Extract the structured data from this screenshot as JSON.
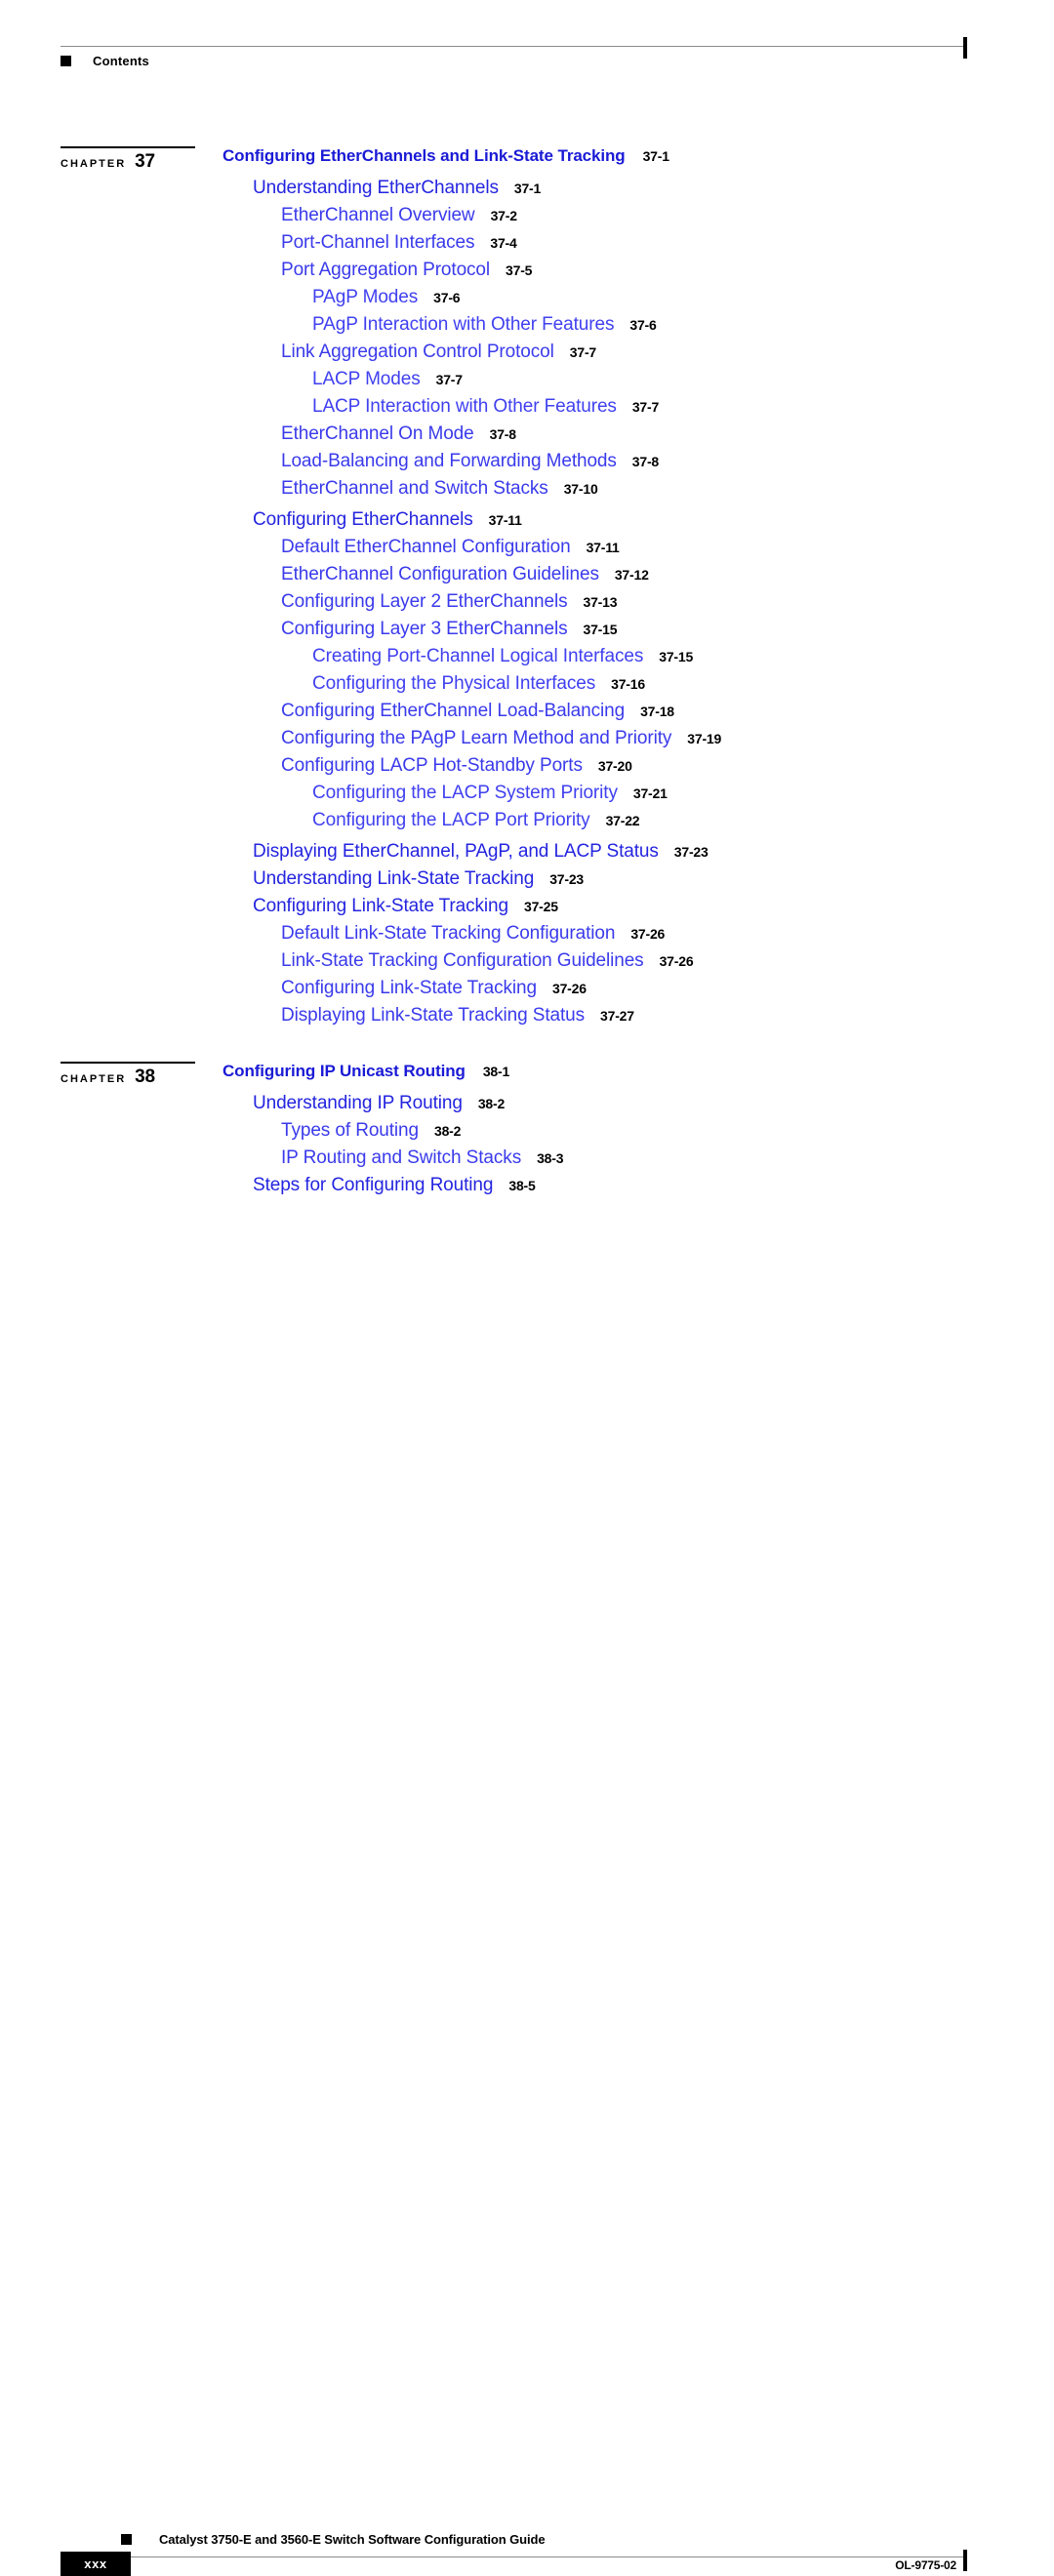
{
  "header": {
    "label": "Contents",
    "square_icon": "black-square-marker"
  },
  "colors": {
    "chapter_title_blue": "#1a1ad6",
    "level1_blue": "#2424e0",
    "level2_blue": "#3a3aec",
    "level3_blue": "#4040f0",
    "page_number_black": "#000000"
  },
  "toc": {
    "chapters": [
      {
        "chapter_word": "CHAPTER",
        "chapter_number": "37",
        "entries": [
          {
            "level": 0,
            "title": "Configuring EtherChannels and Link-State Tracking",
            "page": "37-1",
            "gap_before": false
          },
          {
            "level": 1,
            "title": "Understanding EtherChannels",
            "page": "37-1",
            "gap_before": false
          },
          {
            "level": 2,
            "title": "EtherChannel Overview",
            "page": "37-2",
            "gap_before": false
          },
          {
            "level": 2,
            "title": "Port-Channel Interfaces",
            "page": "37-4",
            "gap_before": false
          },
          {
            "level": 2,
            "title": "Port Aggregation Protocol",
            "page": "37-5",
            "gap_before": false
          },
          {
            "level": 3,
            "title": "PAgP Modes",
            "page": "37-6",
            "gap_before": false
          },
          {
            "level": 3,
            "title": "PAgP Interaction with Other Features",
            "page": "37-6",
            "gap_before": false
          },
          {
            "level": 2,
            "title": "Link Aggregation Control Protocol",
            "page": "37-7",
            "gap_before": false
          },
          {
            "level": 3,
            "title": "LACP Modes",
            "page": "37-7",
            "gap_before": false
          },
          {
            "level": 3,
            "title": "LACP Interaction with Other Features",
            "page": "37-7",
            "gap_before": false
          },
          {
            "level": 2,
            "title": "EtherChannel On Mode",
            "page": "37-8",
            "gap_before": false
          },
          {
            "level": 2,
            "title": "Load-Balancing and Forwarding Methods",
            "page": "37-8",
            "gap_before": false
          },
          {
            "level": 2,
            "title": "EtherChannel and Switch Stacks",
            "page": "37-10",
            "gap_before": false
          },
          {
            "level": 1,
            "title": "Configuring EtherChannels",
            "page": "37-11",
            "gap_before": true
          },
          {
            "level": 2,
            "title": "Default EtherChannel Configuration",
            "page": "37-11",
            "gap_before": false
          },
          {
            "level": 2,
            "title": "EtherChannel Configuration Guidelines",
            "page": "37-12",
            "gap_before": false
          },
          {
            "level": 2,
            "title": "Configuring Layer 2 EtherChannels",
            "page": "37-13",
            "gap_before": false
          },
          {
            "level": 2,
            "title": "Configuring Layer 3 EtherChannels",
            "page": "37-15",
            "gap_before": false
          },
          {
            "level": 3,
            "title": "Creating Port-Channel Logical Interfaces",
            "page": "37-15",
            "gap_before": false
          },
          {
            "level": 3,
            "title": "Configuring the Physical Interfaces",
            "page": "37-16",
            "gap_before": false
          },
          {
            "level": 2,
            "title": "Configuring EtherChannel Load-Balancing",
            "page": "37-18",
            "gap_before": false
          },
          {
            "level": 2,
            "title": "Configuring the PAgP Learn Method and Priority",
            "page": "37-19",
            "gap_before": false
          },
          {
            "level": 2,
            "title": "Configuring LACP Hot-Standby Ports",
            "page": "37-20",
            "gap_before": false
          },
          {
            "level": 3,
            "title": "Configuring the LACP System Priority",
            "page": "37-21",
            "gap_before": false
          },
          {
            "level": 3,
            "title": "Configuring the LACP Port Priority",
            "page": "37-22",
            "gap_before": false
          },
          {
            "level": 1,
            "title": "Displaying EtherChannel, PAgP, and LACP Status",
            "page": "37-23",
            "gap_before": true
          },
          {
            "level": 1,
            "title": "Understanding Link-State Tracking",
            "page": "37-23",
            "gap_before": false
          },
          {
            "level": 1,
            "title": "Configuring Link-State Tracking",
            "page": "37-25",
            "gap_before": false
          },
          {
            "level": 2,
            "title": "Default Link-State Tracking Configuration",
            "page": "37-26",
            "gap_before": false
          },
          {
            "level": 2,
            "title": "Link-State Tracking Configuration Guidelines",
            "page": "37-26",
            "gap_before": false
          },
          {
            "level": 2,
            "title": "Configuring Link-State Tracking",
            "page": "37-26",
            "gap_before": false
          },
          {
            "level": 2,
            "title": "Displaying Link-State Tracking Status",
            "page": "37-27",
            "gap_before": false
          }
        ]
      },
      {
        "chapter_word": "CHAPTER",
        "chapter_number": "38",
        "entries": [
          {
            "level": 0,
            "title": "Configuring IP Unicast Routing",
            "page": "38-1",
            "gap_before": false
          },
          {
            "level": 1,
            "title": "Understanding IP Routing",
            "page": "38-2",
            "gap_before": false
          },
          {
            "level": 2,
            "title": "Types of Routing",
            "page": "38-2",
            "gap_before": false
          },
          {
            "level": 2,
            "title": "IP Routing and Switch Stacks",
            "page": "38-3",
            "gap_before": false
          },
          {
            "level": 1,
            "title": "Steps for Configuring Routing",
            "page": "38-5",
            "gap_before": false
          }
        ]
      }
    ]
  },
  "footer": {
    "guide_title": "Catalyst 3750-E and 3560-E Switch Software Configuration Guide",
    "page_number": "xxx",
    "document_id": "OL-9775-02",
    "square_icon": "black-square-marker"
  }
}
